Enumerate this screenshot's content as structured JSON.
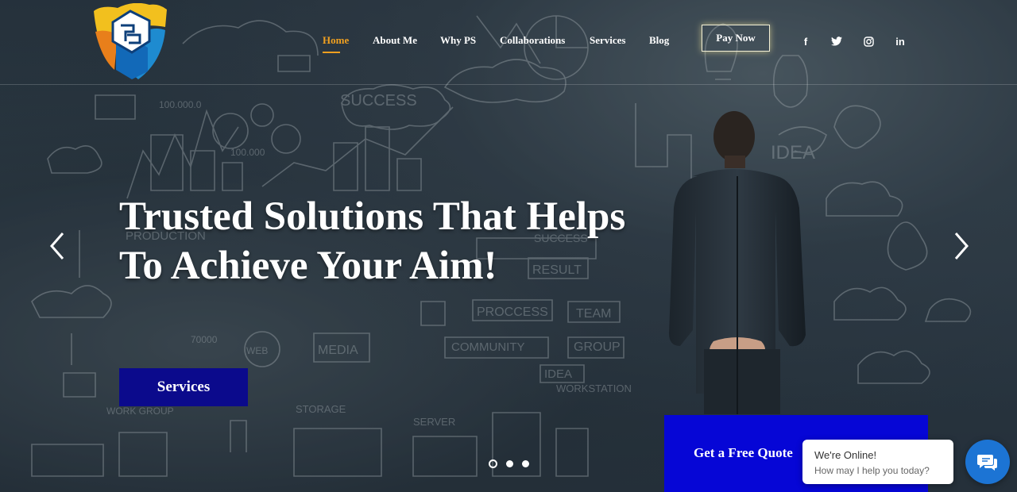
{
  "nav": {
    "items": [
      {
        "label": "Home",
        "active": true
      },
      {
        "label": "About Me",
        "active": false
      },
      {
        "label": "Why PS",
        "active": false
      },
      {
        "label": "Collaborations",
        "active": false
      },
      {
        "label": "Services",
        "active": false
      },
      {
        "label": "Blog",
        "active": false
      }
    ],
    "pay_button": "Pay Now",
    "social": [
      {
        "icon": "facebook-icon",
        "glyph": "f"
      },
      {
        "icon": "twitter-icon",
        "glyph": "t"
      },
      {
        "icon": "instagram-icon",
        "glyph": "◎"
      },
      {
        "icon": "linkedin-icon",
        "glyph": "in"
      }
    ]
  },
  "hero": {
    "headline_line1": "Trusted Solutions That Helps",
    "headline_line2": "To Achieve Your Aim!",
    "cta_button": "Services",
    "slides": {
      "count": 3,
      "active": 1
    },
    "background_doodles": [
      "SUCCESS",
      "PRODUCTION",
      "RESULT",
      "PROCCESS",
      "TEAM",
      "COMMUNITY",
      "GROUP",
      "MEDIA",
      "IDEA",
      "WEB",
      "STORAGE",
      "SERVER",
      "WORKSTATION",
      "WORK GROUP",
      "100.000.0",
      "100.000",
      "70000"
    ]
  },
  "quote": {
    "label": "Get a Free Quote"
  },
  "chat": {
    "title": "We're Online!",
    "subtitle": "How may I help you today?"
  },
  "colors": {
    "accent": "#f0a020",
    "cta_bg": "#0b0a8c",
    "quote_bg": "#0606d6",
    "chat_bg": "#1c74d4"
  }
}
